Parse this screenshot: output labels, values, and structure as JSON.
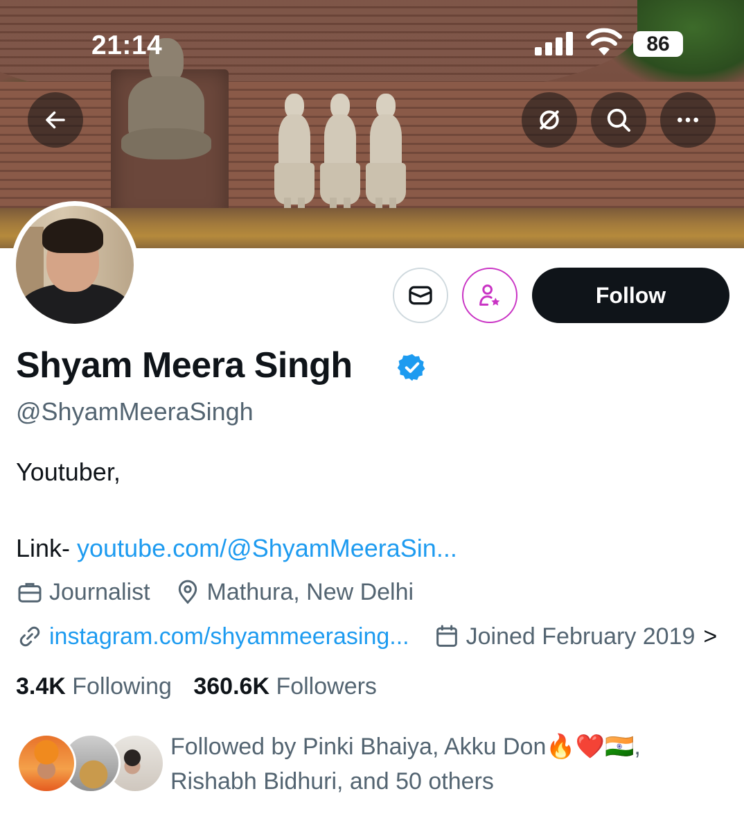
{
  "status_bar": {
    "time": "21:14",
    "battery": "86"
  },
  "profile": {
    "display_name": "Shyam Meera Singh",
    "handle": "@ShyamMeeraSingh",
    "bio_line1": "Youtuber,",
    "bio_link_prefix": "Link- ",
    "bio_link": "youtube.com/@ShyamMeeraSin...",
    "profession": "Journalist",
    "location": "Mathura, New Delhi",
    "website": "instagram.com/shyammeerasing...",
    "joined": "Joined February 2019",
    "joined_chevron": ">",
    "following_count": "3.4K",
    "following_label": "Following",
    "followers_count": "360.6K",
    "followers_label": "Followers",
    "followed_by_line1": "Followed by Pinki Bhaiya, Akku Don🔥❤️🇮🇳,",
    "followed_by_line2": "Rishabh Bidhuri, and 50 others"
  },
  "actions": {
    "follow_label": "Follow"
  },
  "icons": {
    "back": "arrow-left-icon",
    "grok": "grok-icon",
    "search": "search-icon",
    "more": "more-icon",
    "message": "envelope-icon",
    "subscribe": "person-star-icon",
    "verified": "verified-badge-icon",
    "profession": "briefcase-icon",
    "location": "location-pin-icon",
    "website": "link-icon",
    "joined": "calendar-icon"
  },
  "colors": {
    "accent": "#1d9bf0",
    "text": "#0f1419",
    "secondary": "#536471",
    "subscribe": "#c933c4"
  }
}
